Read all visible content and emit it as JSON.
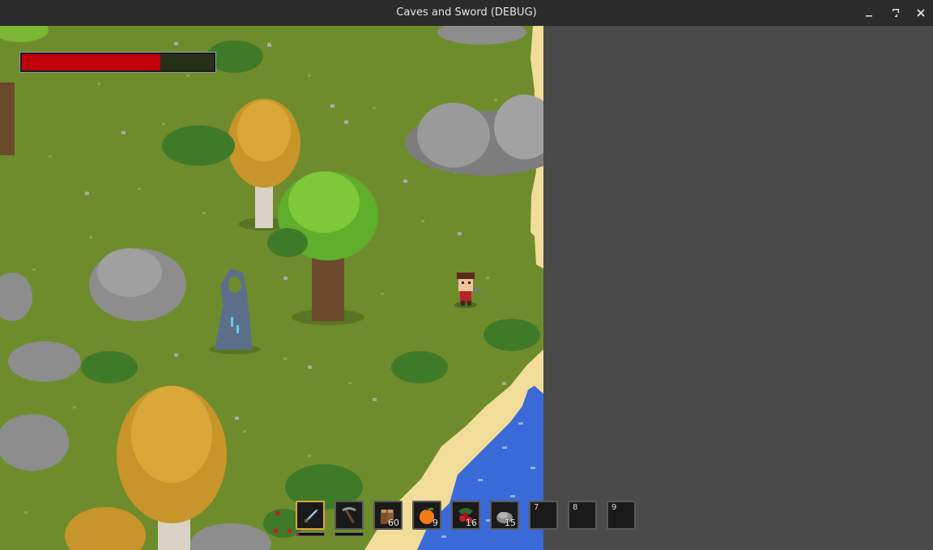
{
  "window": {
    "title": "Caves and Sword (DEBUG)",
    "controls": [
      "minimize-icon",
      "maximize-icon",
      "close-icon"
    ]
  },
  "hud": {
    "health_fraction": 0.72,
    "health_color": "#c0000a"
  },
  "hotbar": {
    "selected_index": 0,
    "slots": [
      {
        "item": "sword-icon",
        "count": "",
        "number": "",
        "durability": 0.1
      },
      {
        "item": "pickaxe-icon",
        "count": "",
        "number": "",
        "durability": 0.0
      },
      {
        "item": "wood-log-icon",
        "count": "60",
        "number": ""
      },
      {
        "item": "orange-fruit-icon",
        "count": "9",
        "number": ""
      },
      {
        "item": "berries-icon",
        "count": "16",
        "number": ""
      },
      {
        "item": "stone-icon",
        "count": "15",
        "number": ""
      },
      {
        "item": "",
        "count": "",
        "number": "7"
      },
      {
        "item": "",
        "count": "",
        "number": "8"
      },
      {
        "item": "",
        "count": "",
        "number": "9"
      }
    ]
  },
  "colors": {
    "grass": "#6f8c2c",
    "sand": "#f2dc9a",
    "water": "#3a6ad8",
    "rock": "#8d8d8d",
    "background": "#4a4a4a"
  }
}
